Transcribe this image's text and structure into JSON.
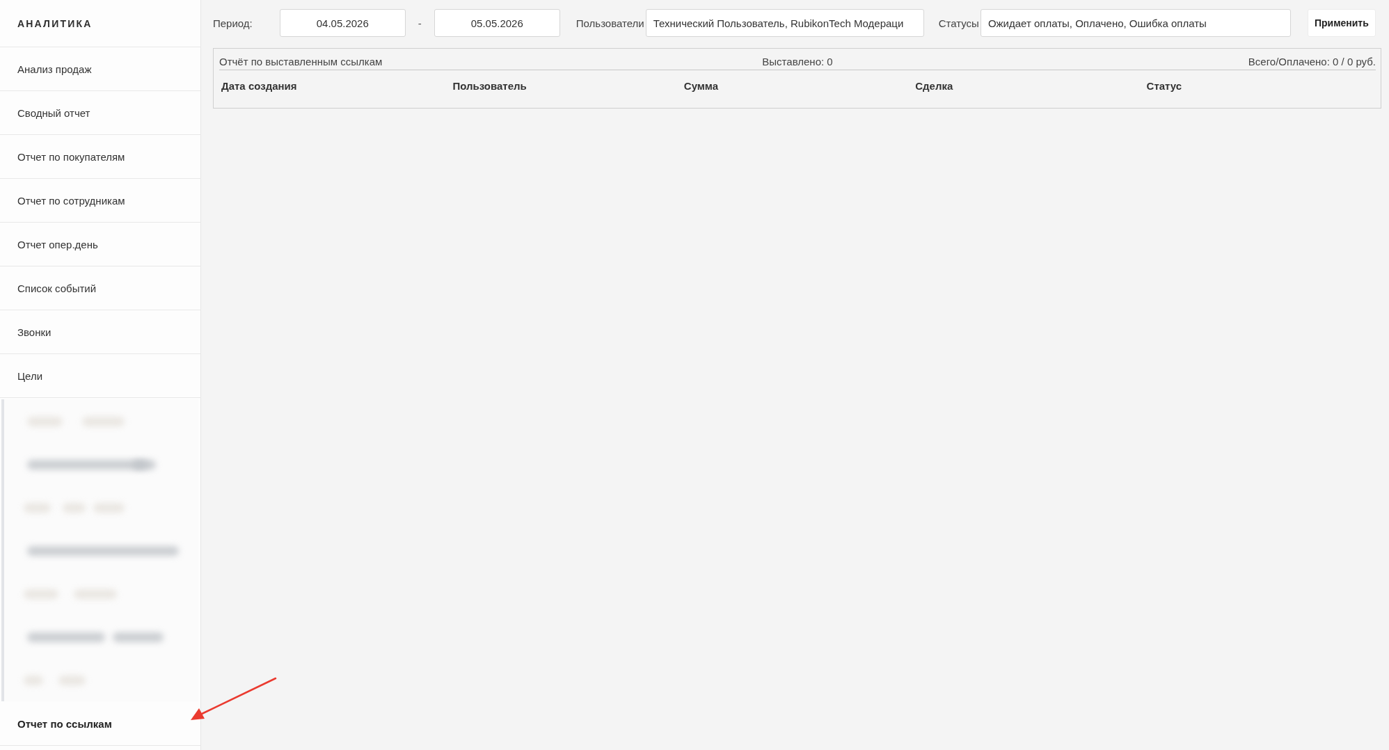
{
  "sidebar": {
    "title": "АНАЛИТИКА",
    "items": [
      {
        "label": "Анализ продаж",
        "selected": false
      },
      {
        "label": "Сводный отчет",
        "selected": false
      },
      {
        "label": "Отчет по покупателям",
        "selected": false
      },
      {
        "label": "Отчет по сотрудникам",
        "selected": false
      },
      {
        "label": "Отчет опер.день",
        "selected": false
      },
      {
        "label": "Список событий",
        "selected": false
      },
      {
        "label": "Звонки",
        "selected": false
      },
      {
        "label": "Цели",
        "selected": false
      }
    ],
    "items_below": [
      {
        "label": "Отчет по ссылкам",
        "selected": true
      }
    ]
  },
  "filters": {
    "period": {
      "label": "Период:",
      "from": "04.05.2026",
      "separator": "-",
      "to": "05.05.2026"
    },
    "users": {
      "label": "Пользователи",
      "value": "Технический Пользователь, RubikonTech Модераци"
    },
    "statuses": {
      "label": "Статусы",
      "value": "Ожидает оплаты, Оплачено, Ошибка оплаты"
    },
    "apply_button": "Применить"
  },
  "report": {
    "title": "Отчёт по выставленным ссылкам",
    "issued": "Выставлено: 0",
    "total_paid": "Всего/Оплачено: 0 / 0 руб.",
    "columns": [
      "Дата создания",
      "Пользователь",
      "Сумма",
      "Сделка",
      "Статус"
    ]
  }
}
